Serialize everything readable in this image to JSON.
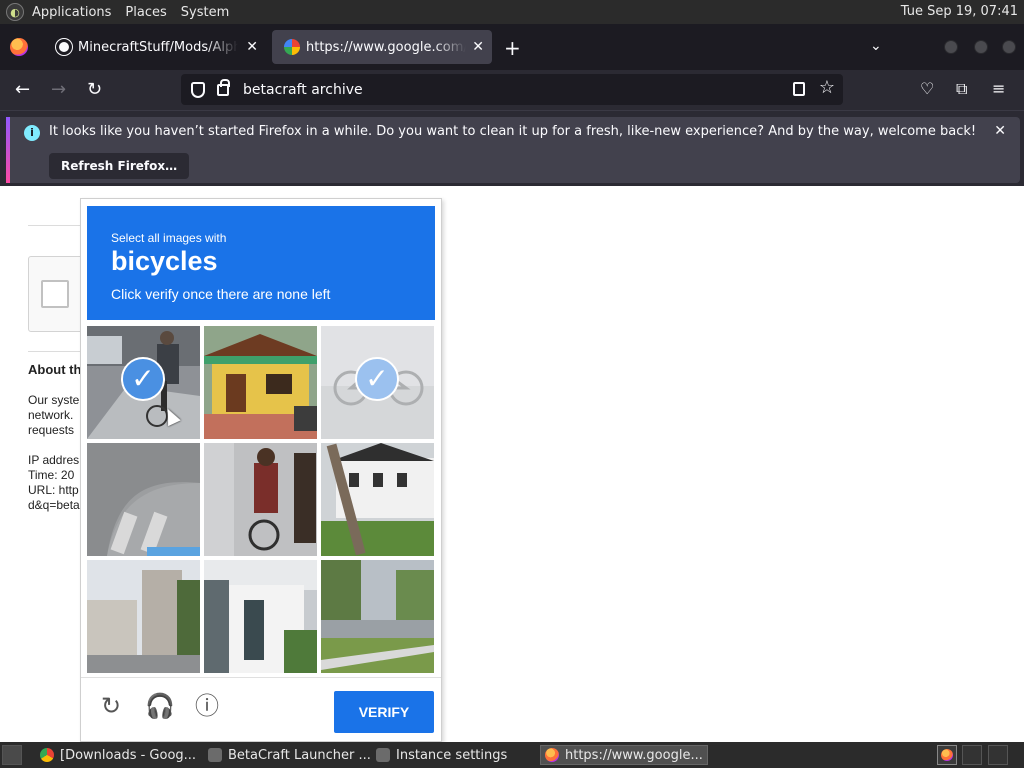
{
  "system_panel": {
    "menus": [
      "Applications",
      "Places",
      "System"
    ],
    "clock": "Tue Sep 19, 07:41"
  },
  "browser": {
    "tabs": [
      {
        "label": "MinecraftStuff/Mods/Alpha",
        "icon": "github-icon"
      },
      {
        "label": "https://www.google.com/se",
        "icon": "google-icon",
        "active": true
      }
    ],
    "url": "betacraft archive",
    "notification": {
      "text": "It looks like you haven’t started Firefox in a while. Do you want to clean it up for a fresh, like-new experience? And by the way, welcome back!",
      "button": "Refresh Firefox…"
    }
  },
  "page": {
    "about_heading": "About th",
    "body_lines": [
      "Our syste",
      "network.",
      "requests"
    ],
    "details_lines": [
      "IP addres",
      "Time: 20",
      "URL: http",
      "d&q=beta"
    ]
  },
  "captcha": {
    "instruction_small": "Select all images with",
    "target": "bicycles",
    "instruction_sub": "Click verify once there are none left",
    "verify_label": "VERIFY",
    "selected_tiles": [
      0,
      2
    ],
    "footer_icons": [
      "reload-icon",
      "audio-icon",
      "info-icon"
    ]
  },
  "taskbar": {
    "tasks": [
      {
        "label": "[Downloads - Goog...",
        "icon": "chrome-icon"
      },
      {
        "label": "BetaCraft Launcher ...",
        "icon": "java-icon"
      },
      {
        "label": "Instance settings",
        "icon": "java-icon"
      },
      {
        "label": "https://www.google...",
        "icon": "firefox-icon",
        "active": true
      }
    ]
  },
  "colors": {
    "captcha_blue": "#1a73e8",
    "firefox_dark": "#1c1b22",
    "notification_bg": "#42414d"
  }
}
